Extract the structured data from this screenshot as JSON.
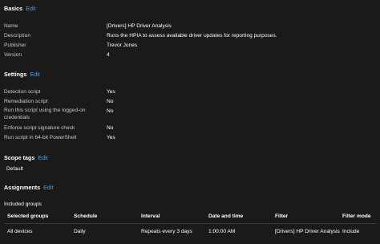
{
  "basics": {
    "title": "Basics",
    "edit": "Edit",
    "fields": [
      {
        "label": "Name",
        "value": "[Drivers] HP Driver Analysis"
      },
      {
        "label": "Description",
        "value": "Runs the HPIA to assess available driver updates for reporting purposes."
      },
      {
        "label": "Publisher",
        "value": "Trevor Jones"
      },
      {
        "label": "Version",
        "value": "4"
      }
    ]
  },
  "settings": {
    "title": "Settings",
    "edit": "Edit",
    "fields": [
      {
        "label": "Detection script",
        "value": "Yes"
      },
      {
        "label": "Remediation script",
        "value": "No"
      },
      {
        "label": "Run this script using the logged-on credentials",
        "value": "No"
      },
      {
        "label": "Enforce script signature check",
        "value": "No"
      },
      {
        "label": "Run script in 64-bit PowerShell",
        "value": "Yes"
      }
    ]
  },
  "scope_tags": {
    "title": "Scope tags",
    "edit": "Edit",
    "value": "Default"
  },
  "assignments": {
    "title": "Assignments",
    "edit": "Edit",
    "included_label": "Included groups",
    "columns": [
      "Selected groups",
      "Schedule",
      "Interval",
      "Date and time",
      "Filter",
      "Filter mode"
    ],
    "rows": [
      [
        "All devices",
        "Daily",
        "Repeats every 3 days",
        "1:00:00 AM",
        "[Drivers] HP Driver Analysis",
        "Include"
      ]
    ]
  }
}
